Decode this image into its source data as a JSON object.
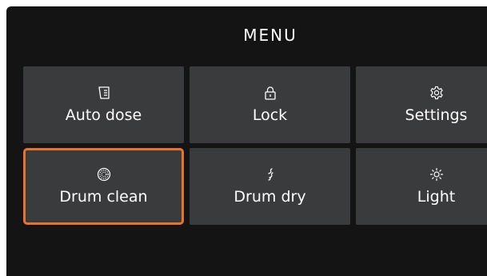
{
  "menu": {
    "title": "MENU",
    "items": [
      {
        "label": "Auto dose",
        "icon": "auto-dose-icon",
        "selected": false
      },
      {
        "label": "Lock",
        "icon": "lock-icon",
        "selected": false
      },
      {
        "label": "Settings",
        "icon": "gear-icon",
        "selected": false
      },
      {
        "label": "Drum clean",
        "icon": "drum-clean-icon",
        "selected": true
      },
      {
        "label": "Drum dry",
        "icon": "drum-dry-icon",
        "selected": false
      },
      {
        "label": "Light",
        "icon": "light-icon",
        "selected": false
      }
    ]
  },
  "colors": {
    "background": "#141414",
    "tile": "#3a3b3d",
    "selection_accent": "#e8742c",
    "text": "#ffffff"
  }
}
